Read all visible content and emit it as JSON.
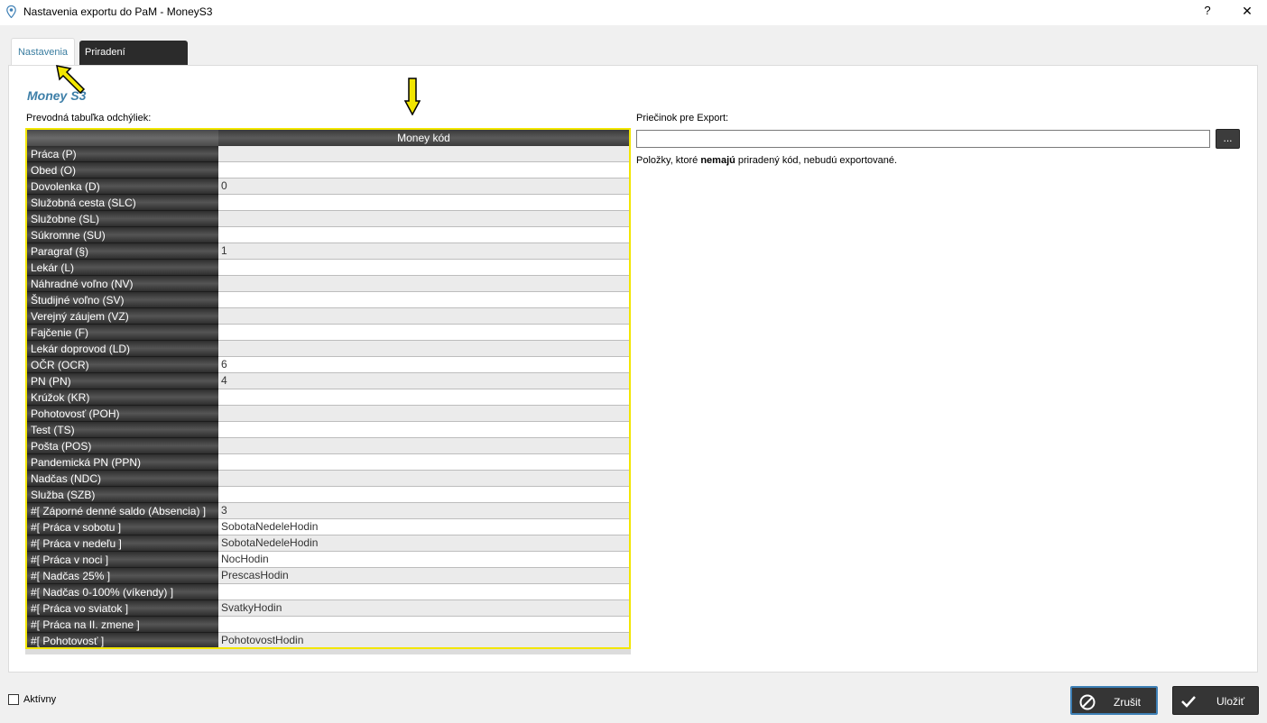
{
  "window": {
    "title": "Nastavenia exportu do PaM - MoneyS3",
    "help_label": "?",
    "close_label": "✕"
  },
  "tabs": [
    {
      "label": "Nastavenia",
      "active": true
    },
    {
      "label": "Priradení zamestnanci",
      "active": false
    }
  ],
  "logo_text": "Money S3",
  "table": {
    "label": "Prevodná tabuľka odchýliek:",
    "column_header": "Money kód",
    "rows": [
      {
        "name": "Práca   (P)",
        "code": ""
      },
      {
        "name": "Obed   (O)",
        "code": ""
      },
      {
        "name": "Dovolenka   (D)",
        "code": "0"
      },
      {
        "name": "Služobná cesta   (SLC)",
        "code": ""
      },
      {
        "name": "Služobne   (SL)",
        "code": ""
      },
      {
        "name": "Súkromne   (SU)",
        "code": ""
      },
      {
        "name": "Paragraf   (§)",
        "code": "1"
      },
      {
        "name": "Lekár   (L)",
        "code": ""
      },
      {
        "name": "Náhradné voľno   (NV)",
        "code": ""
      },
      {
        "name": "Študijné voľno   (SV)",
        "code": ""
      },
      {
        "name": "Verejný záujem   (VZ)",
        "code": ""
      },
      {
        "name": "Fajčenie   (F)",
        "code": ""
      },
      {
        "name": "Lekár doprovod   (LD)",
        "code": ""
      },
      {
        "name": "OČR   (OCR)",
        "code": "6"
      },
      {
        "name": "PN   (PN)",
        "code": "4"
      },
      {
        "name": "Krúžok   (KR)",
        "code": ""
      },
      {
        "name": "Pohotovosť   (POH)",
        "code": ""
      },
      {
        "name": "Test   (TS)",
        "code": ""
      },
      {
        "name": "Pošta   (POS)",
        "code": ""
      },
      {
        "name": "Pandemická PN   (PPN)",
        "code": ""
      },
      {
        "name": "Nadčas   (NDC)",
        "code": ""
      },
      {
        "name": "Služba   (SZB)",
        "code": ""
      },
      {
        "name": " #[ Záporné denné saldo (Absencia) ]",
        "code": "3"
      },
      {
        "name": " #[ Práca v sobotu ]",
        "code": "SobotaNedeleHodin"
      },
      {
        "name": " #[ Práca v nedeľu ]",
        "code": "SobotaNedeleHodin"
      },
      {
        "name": " #[ Práca v noci ]",
        "code": "NocHodin"
      },
      {
        "name": " #[ Nadčas 25% ]",
        "code": "PrescasHodin"
      },
      {
        "name": " #[ Nadčas 0-100% (víkendy) ]",
        "code": ""
      },
      {
        "name": " #[ Práca vo sviatok ]",
        "code": "SvatkyHodin"
      },
      {
        "name": " #[ Práca na II. zmene ]",
        "code": ""
      },
      {
        "name": " #[ Pohotovosť ]",
        "code": "PohotovostHodin"
      }
    ]
  },
  "export": {
    "folder_label": "Priečinok pre Export:",
    "folder_value": "",
    "browse_label": "...",
    "note_prefix": "Položky, ktoré ",
    "note_bold": "nemajú",
    "note_suffix": " priradený kód, nebudú exportované."
  },
  "footer": {
    "active_label": "Aktívny",
    "active_checked": false,
    "cancel_label": "Zrušit",
    "save_label": "Uložiť"
  },
  "colors": {
    "accent": "#3d7fa8",
    "highlight": "#f2e600",
    "dark_button": "#353535"
  }
}
